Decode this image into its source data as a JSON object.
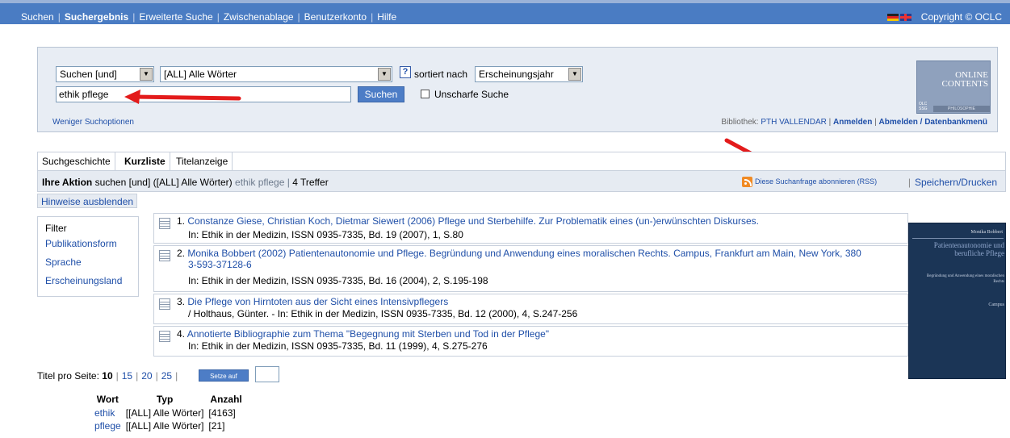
{
  "topnav": {
    "items": [
      "Suchen",
      "Suchergebnis",
      "Erweiterte Suche",
      "Zwischenablage",
      "Benutzerkonto",
      "Hilfe"
    ],
    "active": "Suchergebnis",
    "copyright": "Copyright © OCLC",
    "flags": [
      "german-flag-icon",
      "uk-flag-icon"
    ]
  },
  "search": {
    "operator_select": "Suchen [und]",
    "field_select": "[ALL] Alle Wörter",
    "help_label": "?",
    "sort_label": "sortiert nach",
    "sort_select": "Erscheinungsjahr",
    "query": "ethik pflege",
    "search_button": "Suchen",
    "fuzzy_label": "Unscharfe Suche",
    "fewer_options": "Weniger Suchoptionen",
    "library_label": "Bibliothek:",
    "library_name": "PTH VALLENDAR",
    "login": "Anmelden",
    "logout": "Abmelden / Datenbankmenü",
    "logo_text": [
      "ONLINE",
      "CONTENTS"
    ],
    "logo_small": [
      "OLC",
      "SSG"
    ],
    "logo_subject": "PHILOSOPHIE"
  },
  "tabs": [
    "Suchgeschichte",
    "Kurzliste",
    "Titelanzeige"
  ],
  "active_tab": "Kurzliste",
  "action_bar": {
    "label": "Ihre Aktion",
    "action": "suchen [und] ([ALL] Alle Wörter)",
    "query": "ethik pflege",
    "sep": "|",
    "hits": "4 Treffer",
    "rss_link": "Diese Suchanfrage abonnieren (RSS)",
    "save_link": "Speichern/Drucken"
  },
  "hide_hints": "Hinweise ausblenden",
  "filter": {
    "title": "Filter",
    "items": [
      "Publikationsform",
      "Sprache",
      "Erscheinungsland"
    ]
  },
  "results": [
    {
      "num": "1.",
      "title": "Constanze Giese, Christian Koch, Dietmar Siewert (2006) Pflege und Sterbehilfe. Zur Problematik eines (un-)erwünschten Diskurses.",
      "title_cont": "",
      "source": "In: Ethik in der Medizin, ISSN 0935-7335, Bd. 19 (2007), 1, S.80"
    },
    {
      "num": "2.",
      "title": "Monika Bobbert (2002) Patientenautonomie und Pflege. Begründung und Anwendung eines moralischen Rechts. Campus, Frankfurt am Main, New York, 380",
      "title_cont": "3-593-37128-6",
      "source": "In: Ethik in der Medizin, ISSN 0935-7335, Bd. 16 (2004), 2, S.195-198"
    },
    {
      "num": "3.",
      "title": "Die Pflege von Hirntoten aus der Sicht eines Intensivpflegers",
      "title_cont": "",
      "source": "/ Holthaus, Günter. - In: Ethik in der Medizin, ISSN 0935-7335, Bd. 12 (2000), 4, S.247-256"
    },
    {
      "num": "4.",
      "title": "Annotierte Bibliographie zum Thema \"Begegnung mit Sterben und Tod in der Pflege\"",
      "title_cont": "",
      "source": "In: Ethik in der Medizin, ISSN 0935-7335, Bd. 11 (1999), 4, S.275-276"
    }
  ],
  "book_cover": {
    "author": "Monika Bobbert",
    "title": "Patientenautonomie und berufliche Pflege",
    "subtitle": "Begründung und Anwendung eines moralischen Rechts",
    "publisher": "Campus"
  },
  "pager": {
    "label": "Titel pro Seite:",
    "current": "10",
    "options": [
      "15",
      "20",
      "25"
    ],
    "set_button": "Setze auf",
    "input_value": ""
  },
  "word_table": {
    "headers": [
      "Wort",
      "Typ",
      "Anzahl"
    ],
    "rows": [
      {
        "word": "ethik",
        "type": "[[ALL] Alle Wörter]",
        "count": "[4163]"
      },
      {
        "word": "pflege",
        "type": "[[ALL] Alle Wörter]",
        "count": "[21]"
      }
    ]
  },
  "colors": {
    "nav_bar": "#4a7cc3",
    "link": "#1f4fa8",
    "panel": "#e8edf4",
    "annotation_arrow": "#e31b1b"
  }
}
